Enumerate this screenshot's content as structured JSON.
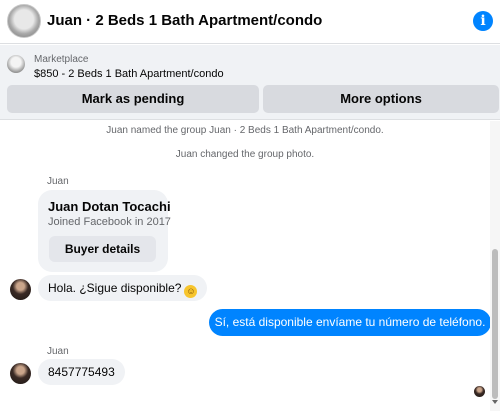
{
  "header": {
    "title": "Juan · 2 Beds 1 Bath Apartment/condo",
    "info_icon": "i"
  },
  "marketplace": {
    "label": "Marketplace",
    "listing": "$850 - 2 Beds 1 Bath Apartment/condo",
    "pending_button": "Mark as pending",
    "more_button": "More options"
  },
  "chat": {
    "system_messages": [
      "Juan named the group Juan · 2 Beds 1 Bath Apartment/condo.",
      "Juan changed the group photo."
    ],
    "sender_name": "Juan",
    "profile_card": {
      "name": "Juan Dotan Tocachi",
      "joined": "Joined Facebook in 2017",
      "button": "Buyer details"
    },
    "messages": [
      {
        "direction": "incoming",
        "text": "Hola. ¿Sigue disponible?",
        "emoji": "smiling-face"
      },
      {
        "direction": "outgoing",
        "text": "Sí, está disponible envíame tu número de teléfono."
      },
      {
        "direction": "incoming",
        "sender": "Juan",
        "text": "8457775493"
      }
    ]
  },
  "colors": {
    "accent": "#0084ff",
    "bubble_incoming": "#f0f2f5",
    "muted_text": "#65676b"
  }
}
